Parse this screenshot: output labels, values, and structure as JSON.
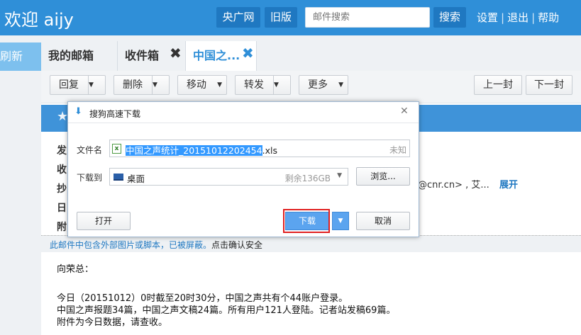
{
  "header": {
    "welcome": "欢迎 aijy",
    "btn_cnr": "央广网",
    "btn_old": "旧版",
    "search_placeholder": "邮件搜索",
    "btn_search": "搜索",
    "link_settings": "设置",
    "link_logout": "退出",
    "link_help": "帮助"
  },
  "sidebar": {
    "refresh": "刷新"
  },
  "tabs": [
    {
      "label": "我的邮箱"
    },
    {
      "label": "收件箱"
    },
    {
      "label": "中国之..."
    }
  ],
  "toolbar": {
    "reply": "回复",
    "delete": "删除",
    "move": "移动",
    "forward": "转发",
    "more": "更多",
    "prev": "上一封",
    "next": "下一封"
  },
  "mail": {
    "field_labels": [
      "发",
      "收",
      "抄",
      "日",
      "附"
    ],
    "cc_tail": "@cnr.cn> , 艾...",
    "expand": "展开",
    "warning": "此邮件中包含外部图片或脚本，已被屏蔽。",
    "warning_link": "点击确认安全",
    "greeting": "向荣总：",
    "lines": [
      "今日（20151012）0时截至20时30分，中国之声共有个44账户登录。",
      "中国之声报题34篇，中国之声文稿24篇。所有用户121人登陆。记者站发稿69篇。",
      "附件为今日数据，请查收。"
    ]
  },
  "dialog": {
    "title": "搜狗高速下载",
    "label_filename": "文件名",
    "filename_selected": "中国之声统计_20151012202454",
    "filename_ext": ".xls",
    "size": "未知",
    "label_saveto": "下载到",
    "dest": "桌面",
    "free_space": "剩余136GB",
    "btn_browse": "浏览...",
    "btn_open": "打开",
    "btn_download": "下载",
    "btn_cancel": "取消"
  }
}
